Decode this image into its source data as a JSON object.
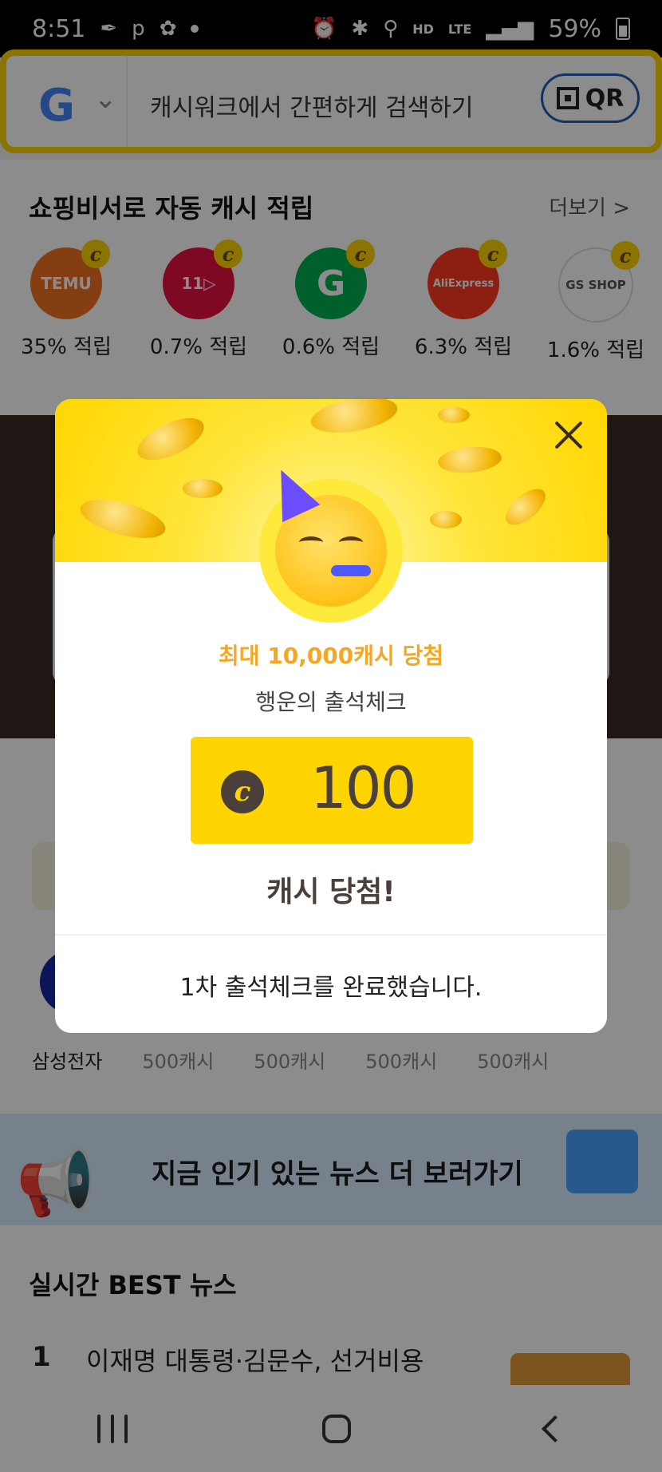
{
  "status_bar": {
    "time": "8:51",
    "left_icons": [
      "feather-icon",
      "p-icon",
      "flower-icon"
    ],
    "right_text_hd": "HD",
    "right_text_lte": "LTE",
    "battery": "59%"
  },
  "search": {
    "placeholder": "캐시워크에서 간편하게 검색하기",
    "qr_label": "QR"
  },
  "shopping": {
    "title": "쇼핑비서로 자동 캐시 적립",
    "more_label": "더보기 >",
    "merchants": [
      {
        "logo_text": "TEMU",
        "rate": "35% 적립",
        "color": "#f36f21"
      },
      {
        "logo_text": "11▷",
        "rate": "0.7% 적립",
        "color": "#e8103f"
      },
      {
        "logo_text": "G",
        "rate": "0.6% 적립",
        "color": "#00b050"
      },
      {
        "logo_text": "AliExpress",
        "rate": "6.3% 적립",
        "color": "#ff3a1f"
      },
      {
        "logo_text": "GS SHOP",
        "rate": "1.6% 적립",
        "color": "#dddddd"
      }
    ]
  },
  "companies": [
    "삼성전자",
    "500캐시",
    "500캐시",
    "500캐시",
    "500캐시"
  ],
  "news_banner": {
    "text": "지금 인기 있는 뉴스 더 보러가기"
  },
  "best_news": {
    "title": "실시간 BEST 뉴스",
    "items": [
      {
        "rank": "1",
        "headline": "이재명 대통령·김문수, 선거비용"
      }
    ]
  },
  "modal": {
    "headline": "최대 10,000캐시 당첨",
    "subtitle": "행운의 출석체크",
    "currency_symbol": "c",
    "amount": "100",
    "won_label": "캐시 당첨!",
    "completion_message": "1차 출석체크를 완료했습니다."
  },
  "colors": {
    "brand_yellow": "#ffd400",
    "headline_orange": "#f5a623",
    "modal_text_brown": "#4a3f3a"
  }
}
